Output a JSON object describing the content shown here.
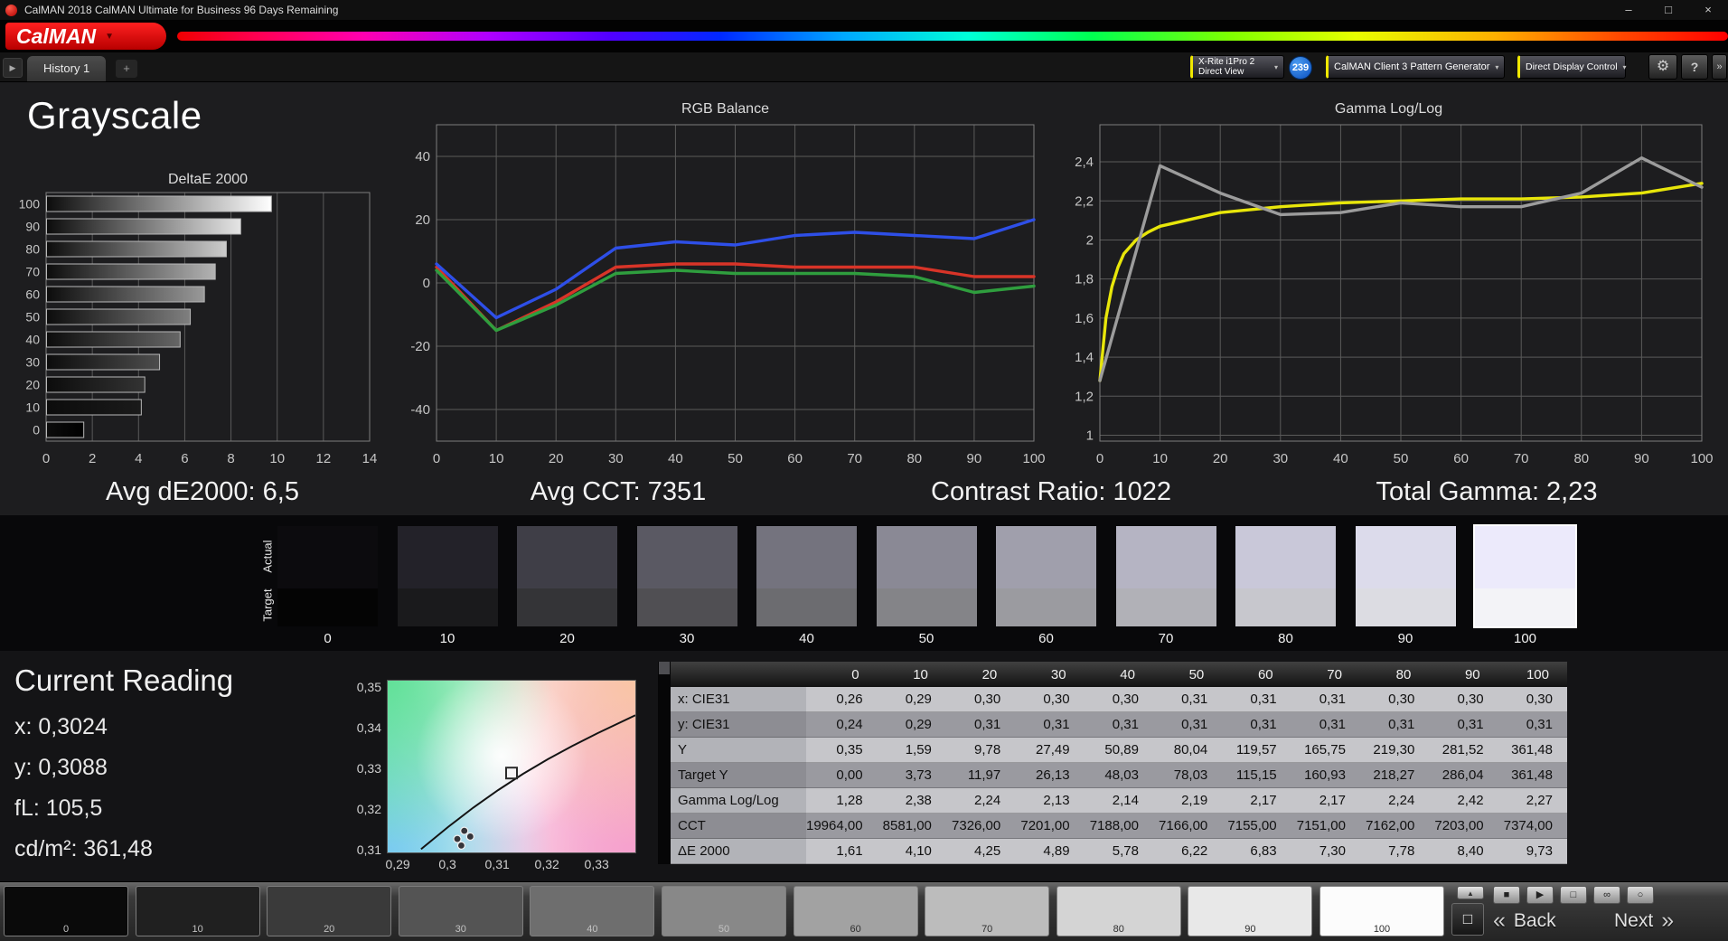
{
  "window": {
    "title": "CalMAN 2018 CalMAN Ultimate for Business 96 Days Remaining",
    "minimize": "–",
    "maximize": "□",
    "close": "×"
  },
  "logo": {
    "text": "CalMAN",
    "caret": "▼"
  },
  "tab_bar": {
    "scroll_left": "▶",
    "history_tab": "History 1",
    "add_tab": "+"
  },
  "toolbar": {
    "meter_device": {
      "line1": "X-Rite i1Pro 2",
      "line2": "Direct View",
      "caret": "▾"
    },
    "meter_count": "239",
    "pattern_generator": {
      "label": "CalMAN Client 3 Pattern Generator",
      "caret": "▾"
    },
    "display_control": {
      "label": "Direct Display Control",
      "caret": "▾"
    },
    "settings_icon": "⚙",
    "help_icon": "?",
    "expand_icon": "»"
  },
  "page_title": "Grayscale",
  "summaries": {
    "avg_de": "Avg dE2000: 6,5",
    "avg_cct": "Avg CCT: 7351",
    "contrast_ratio": "Contrast Ratio: 1022",
    "total_gamma": "Total Gamma: 2,23"
  },
  "swatch_strip": {
    "actual_label": "Actual",
    "target_label": "Target",
    "levels": [
      "0",
      "10",
      "20",
      "30",
      "40",
      "50",
      "60",
      "70",
      "80",
      "90",
      "100"
    ],
    "actual_colors": [
      "#0c0b0e",
      "#232229",
      "#3f3e47",
      "#5a5963",
      "#74737e",
      "#8a8995",
      "#a09fac",
      "#b5b4c3",
      "#c9c8d9",
      "#dcdbeb",
      "#eceafb"
    ],
    "target_colors": [
      "#040404",
      "#1a1a1c",
      "#343437",
      "#504f53",
      "#6c6c70",
      "#848488",
      "#9b9ba0",
      "#b1b1b7",
      "#c7c7cd",
      "#dcdce2",
      "#f3f3f7"
    ],
    "selected_index": 10
  },
  "current_reading": {
    "title": "Current Reading",
    "lines": [
      "x: 0,3024",
      "y: 0,3088",
      "fL: 105,5",
      "cd/m²: 361,48"
    ]
  },
  "table": {
    "columns": [
      "0",
      "10",
      "20",
      "30",
      "40",
      "50",
      "60",
      "70",
      "80",
      "90",
      "100"
    ],
    "rows": [
      {
        "label": "x: CIE31",
        "values": [
          "0,26",
          "0,29",
          "0,30",
          "0,30",
          "0,30",
          "0,31",
          "0,31",
          "0,31",
          "0,30",
          "0,30",
          "0,30"
        ]
      },
      {
        "label": "y: CIE31",
        "values": [
          "0,24",
          "0,29",
          "0,31",
          "0,31",
          "0,31",
          "0,31",
          "0,31",
          "0,31",
          "0,31",
          "0,31",
          "0,31"
        ]
      },
      {
        "label": "Y",
        "values": [
          "0,35",
          "1,59",
          "9,78",
          "27,49",
          "50,89",
          "80,04",
          "119,57",
          "165,75",
          "219,30",
          "281,52",
          "361,48"
        ]
      },
      {
        "label": "Target Y",
        "values": [
          "0,00",
          "3,73",
          "11,97",
          "26,13",
          "48,03",
          "78,03",
          "115,15",
          "160,93",
          "218,27",
          "286,04",
          "361,48"
        ]
      },
      {
        "label": "Gamma Log/Log",
        "values": [
          "1,28",
          "2,38",
          "2,24",
          "2,13",
          "2,14",
          "2,19",
          "2,17",
          "2,17",
          "2,24",
          "2,42",
          "2,27"
        ]
      },
      {
        "label": "CCT",
        "values": [
          "19964,00",
          "8581,00",
          "7326,00",
          "7201,00",
          "7188,00",
          "7166,00",
          "7155,00",
          "7151,00",
          "7162,00",
          "7203,00",
          "7374,00"
        ]
      },
      {
        "label": "ΔE 2000",
        "values": [
          "1,61",
          "4,10",
          "4,25",
          "4,89",
          "5,78",
          "6,22",
          "6,83",
          "7,30",
          "7,78",
          "8,40",
          "9,73"
        ]
      }
    ]
  },
  "chart_data": [
    {
      "id": "deltae",
      "type": "bar",
      "orientation": "horizontal",
      "title": "DeltaE 2000",
      "categories": [
        "100",
        "90",
        "80",
        "70",
        "60",
        "50",
        "40",
        "30",
        "20",
        "10",
        "0"
      ],
      "bar_levels": [
        100,
        90,
        80,
        70,
        60,
        50,
        40,
        30,
        20,
        10,
        0
      ],
      "values": [
        9.73,
        8.4,
        7.78,
        7.3,
        6.83,
        6.22,
        5.78,
        4.89,
        4.25,
        4.1,
        1.61
      ],
      "xlim": [
        0,
        14
      ],
      "xticks": [
        0,
        2,
        4,
        6,
        8,
        10,
        12,
        14
      ],
      "grid": true,
      "footer": "Avg dE2000: 6,5"
    },
    {
      "id": "rgb_balance",
      "type": "line",
      "title": "RGB Balance",
      "x": [
        0,
        10,
        20,
        30,
        40,
        50,
        60,
        70,
        80,
        90,
        100
      ],
      "xticks": [
        0,
        10,
        20,
        30,
        40,
        50,
        60,
        70,
        80,
        90,
        100
      ],
      "ylim": [
        -50,
        50
      ],
      "yticks": [
        40,
        20,
        0,
        -20,
        -40
      ],
      "grid": true,
      "series": [
        {
          "name": "Red",
          "color": "#d83428",
          "values": [
            5,
            -15,
            -6,
            5,
            6,
            6,
            5,
            5,
            5,
            2,
            2
          ]
        },
        {
          "name": "Green",
          "color": "#2f9e3e",
          "values": [
            4,
            -15,
            -7,
            3,
            4,
            3,
            3,
            3,
            2,
            -3,
            -1
          ]
        },
        {
          "name": "Blue",
          "color": "#2e4fe8",
          "values": [
            6,
            -11,
            -2,
            11,
            13,
            12,
            15,
            16,
            15,
            14,
            20
          ]
        }
      ]
    },
    {
      "id": "gamma_loglog",
      "type": "line",
      "title": "Gamma Log/Log",
      "xticks": [
        0,
        10,
        20,
        30,
        40,
        50,
        60,
        70,
        80,
        90,
        100
      ],
      "ylim": [
        0.97,
        2.59
      ],
      "yticks": [
        2.4,
        2.2,
        2.0,
        1.8,
        1.6,
        1.4,
        1.2,
        1.0
      ],
      "ytick_labels": [
        "2,4",
        "2,2",
        "2",
        "1,8",
        "1,6",
        "1,4",
        "1,2",
        "1"
      ],
      "grid": true,
      "series": [
        {
          "name": "Target",
          "color": "#e8e60a",
          "points": [
            [
              0,
              1.28
            ],
            [
              1,
              1.6
            ],
            [
              2,
              1.76
            ],
            [
              3,
              1.86
            ],
            [
              4,
              1.93
            ],
            [
              6,
              2.0
            ],
            [
              8,
              2.04
            ],
            [
              10,
              2.07
            ],
            [
              20,
              2.14
            ],
            [
              30,
              2.17
            ],
            [
              40,
              2.19
            ],
            [
              50,
              2.2
            ],
            [
              60,
              2.21
            ],
            [
              70,
              2.21
            ],
            [
              80,
              2.22
            ],
            [
              90,
              2.24
            ],
            [
              100,
              2.29
            ]
          ]
        },
        {
          "name": "Actual",
          "color": "#9c9c9c",
          "points": [
            [
              0,
              1.28
            ],
            [
              10,
              2.38
            ],
            [
              20,
              2.24
            ],
            [
              30,
              2.13
            ],
            [
              40,
              2.14
            ],
            [
              50,
              2.19
            ],
            [
              60,
              2.17
            ],
            [
              70,
              2.17
            ],
            [
              80,
              2.24
            ],
            [
              90,
              2.42
            ],
            [
              100,
              2.27
            ]
          ]
        }
      ],
      "footer": "Total Gamma: 2,23"
    },
    {
      "id": "cie_detail",
      "type": "scatter",
      "title": "CIE xy detail",
      "xlim": [
        0.2878,
        0.3376
      ],
      "ylim": [
        0.3095,
        0.3517
      ],
      "xticks": [
        {
          "v": 0.29,
          "label": "0,29"
        },
        {
          "v": 0.3,
          "label": "0,3"
        },
        {
          "v": 0.31,
          "label": "0,31"
        },
        {
          "v": 0.32,
          "label": "0,32"
        },
        {
          "v": 0.33,
          "label": "0,33"
        }
      ],
      "yticks": [
        {
          "v": 0.35,
          "label": "0,35"
        },
        {
          "v": 0.34,
          "label": "0,34"
        },
        {
          "v": 0.33,
          "label": "0,33"
        },
        {
          "v": 0.32,
          "label": "0,32"
        },
        {
          "v": 0.31,
          "label": "0,31"
        }
      ],
      "locus": [
        [
          0.2945,
          0.3103
        ],
        [
          0.3,
          0.3158
        ],
        [
          0.305,
          0.3205
        ],
        [
          0.31,
          0.3248
        ],
        [
          0.315,
          0.3288
        ],
        [
          0.32,
          0.3324
        ],
        [
          0.325,
          0.3357
        ],
        [
          0.33,
          0.3388
        ],
        [
          0.3376,
          0.3432
        ]
      ],
      "target_point": {
        "x": 0.3127,
        "y": 0.329
      },
      "points": [
        [
          0.3018,
          0.3128
        ],
        [
          0.3032,
          0.3148
        ],
        [
          0.3026,
          0.3112
        ],
        [
          0.3044,
          0.3134
        ]
      ]
    }
  ],
  "bottom_bar": {
    "patches": [
      {
        "label": "0",
        "color": "#0a0a0a"
      },
      {
        "label": "10",
        "color": "#202020"
      },
      {
        "label": "20",
        "color": "#3a3a3a"
      },
      {
        "label": "30",
        "color": "#545454"
      },
      {
        "label": "40",
        "color": "#6e6e6e"
      },
      {
        "label": "50",
        "color": "#888888"
      },
      {
        "label": "60",
        "color": "#a2a2a2"
      },
      {
        "label": "70",
        "color": "#bcbcbc"
      },
      {
        "label": "80",
        "color": "#d4d4d4"
      },
      {
        "label": "90",
        "color": "#e8e8e8"
      },
      {
        "label": "100",
        "color": "#fcfcfc"
      }
    ],
    "up_icon": "▲",
    "window_icon": "□",
    "transport": [
      {
        "name": "stop-icon",
        "glyph": "■"
      },
      {
        "name": "play-icon",
        "glyph": "▶"
      },
      {
        "name": "pattern-window-icon",
        "glyph": "□"
      },
      {
        "name": "loop-icon",
        "glyph": "∞"
      },
      {
        "name": "record-icon",
        "glyph": "○"
      }
    ],
    "back_chevron": "«",
    "back_label": "Back",
    "next_label": "Next",
    "next_chevron": "»"
  }
}
